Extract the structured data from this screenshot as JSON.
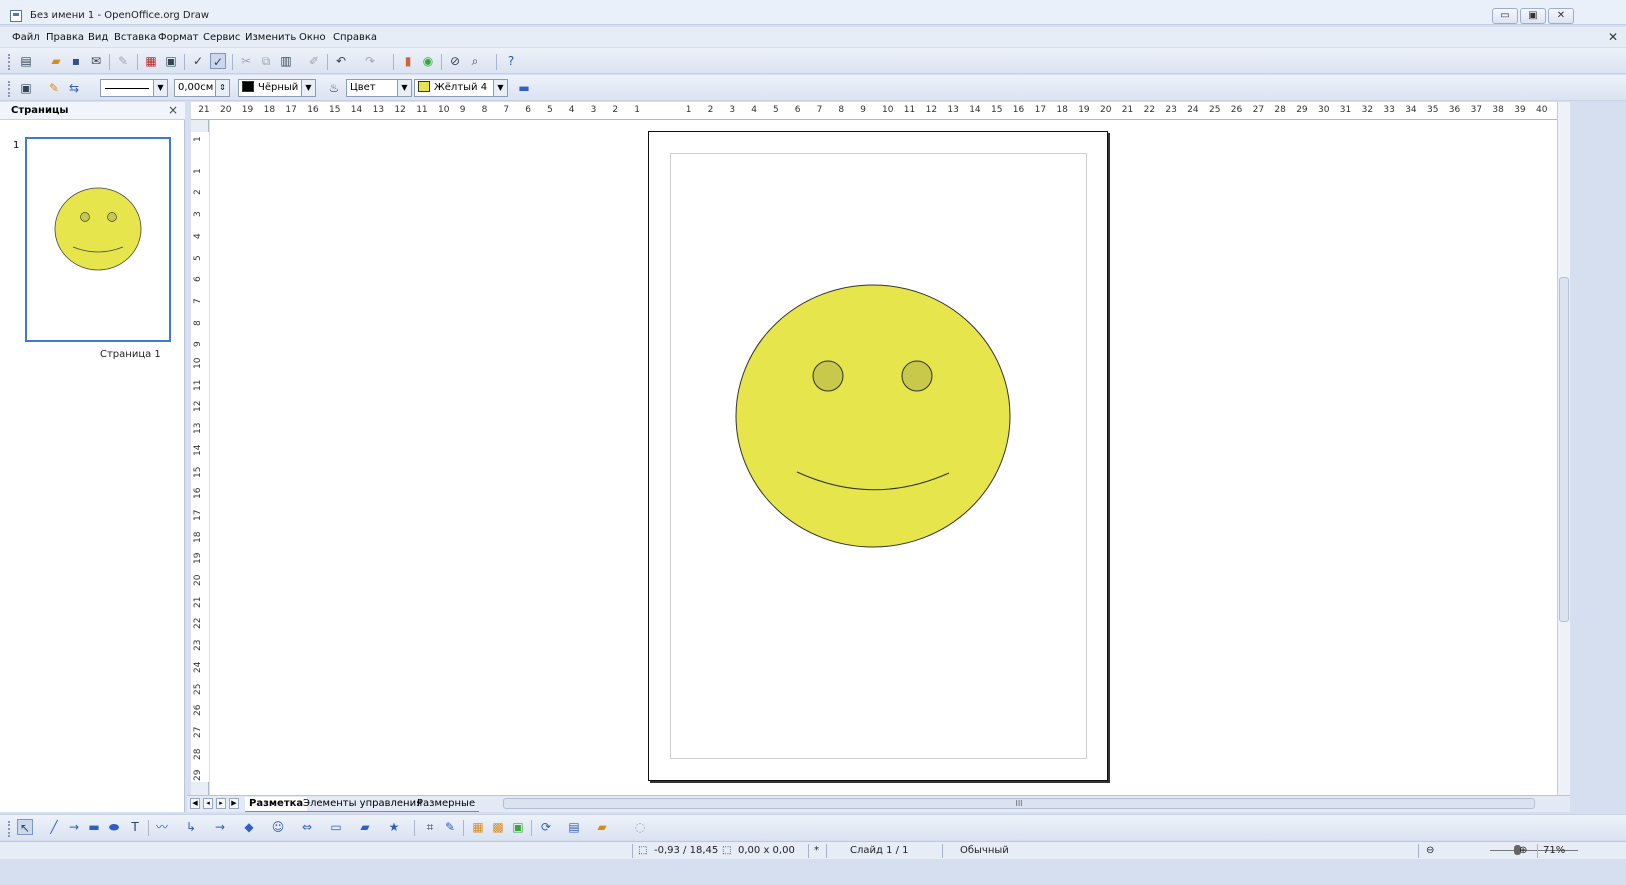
{
  "window": {
    "title": "Без имени 1 - OpenOffice.org Draw",
    "controls": {
      "minimize": "▭",
      "restore": "▣",
      "close": "✕"
    }
  },
  "menu": {
    "items": [
      "Файл",
      "Правка",
      "Вид",
      "Вставка",
      "Формат",
      "Сервис",
      "Изменить",
      "Окно",
      "Справка"
    ],
    "close_symbol": "✕"
  },
  "line_toolbar": {
    "line_width": "0,00см",
    "line_color": {
      "label": "Чёрный",
      "hex": "#000000"
    },
    "area_style": "Цвет",
    "area_color": {
      "label": "Жёлтый 4",
      "hex": "#e6e64c"
    }
  },
  "pages_panel": {
    "title": "Страницы",
    "thumbnail_number": "1",
    "thumbnail_label": "Страница 1"
  },
  "rulers": {
    "horizontal_left": [
      "21",
      "20",
      "19",
      "18",
      "17",
      "16",
      "15",
      "14",
      "13",
      "12",
      "11",
      "10",
      "9",
      "8",
      "7",
      "6",
      "5",
      "4",
      "3",
      "2",
      "1"
    ],
    "horizontal_right": [
      "1",
      "2",
      "3",
      "4",
      "5",
      "6",
      "7",
      "8",
      "9",
      "10",
      "11",
      "12",
      "13",
      "14",
      "15",
      "16",
      "17",
      "18",
      "19",
      "20",
      "21",
      "22",
      "23",
      "24",
      "25",
      "26",
      "27",
      "28",
      "29",
      "30",
      "31",
      "32",
      "33",
      "34",
      "35",
      "36",
      "37",
      "38",
      "39",
      "40"
    ],
    "vertical": [
      "1",
      "1",
      "2",
      "3",
      "4",
      "5",
      "6",
      "7",
      "8",
      "9",
      "10",
      "11",
      "12",
      "13",
      "14",
      "15",
      "16",
      "17",
      "18",
      "19",
      "20",
      "21",
      "22",
      "23",
      "24",
      "25",
      "26",
      "27",
      "28",
      "29"
    ]
  },
  "drawing": {
    "face_fill": "#e6e64c",
    "eye_fill": "#c8c84a",
    "stroke": "#333333"
  },
  "tabs": {
    "items": [
      "Разметка",
      "Элементы управления",
      "Размерные"
    ],
    "active": "Разметка",
    "scroll_grip": "III"
  },
  "status": {
    "position": "-0,93 / 18,45",
    "size": "0,00 x 0,00",
    "modified": "*",
    "slide": "Слайд 1 / 1",
    "layout": "Обычный",
    "zoom": "71%"
  }
}
